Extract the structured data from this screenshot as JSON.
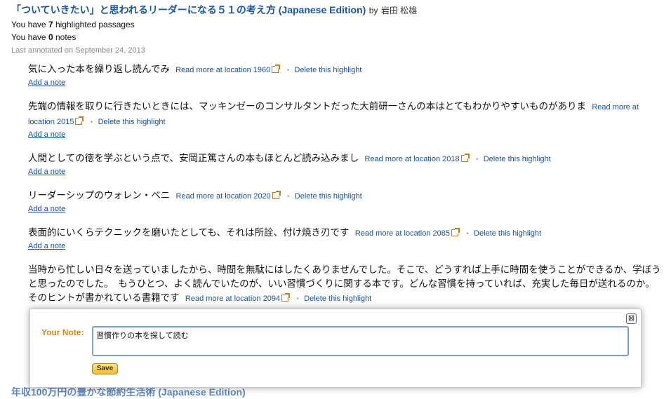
{
  "book": {
    "title": "「ついていきたい」と思われるリーダーになる５１の考え方 (Japanese Edition)",
    "by_label": "by",
    "author": "岩田 松雄",
    "stats": {
      "highlights_prefix": "You have",
      "highlights_count": "7",
      "highlights_suffix": "highlighted passages",
      "notes_prefix": "You have",
      "notes_count": "0",
      "notes_suffix": "notes"
    },
    "last_annotated": "Last annotated on September 24, 2013"
  },
  "highlights": [
    {
      "text": "気に入った本を繰り返し読んでみ",
      "read_more": "Read more at location 1960",
      "delete": "Delete this highlight",
      "add_note": "Add a note"
    },
    {
      "text": "先端の情報を取りに行きたいときには、マッキンゼーのコンサルタントだった大前研一さんの本はとてもわかりやすいものがありま",
      "read_more": "Read more at location 2015",
      "delete": "Delete this highlight",
      "add_note": "Add a note"
    },
    {
      "text": "人間としての徳を学ぶという点で、安岡正篤さんの本もほとんど読み込みまし",
      "read_more": "Read more at location 2018",
      "delete": "Delete this highlight",
      "add_note": "Add a note"
    },
    {
      "text": "リーダーシップのウォレン・ベニ",
      "read_more": "Read more at location 2020",
      "delete": "Delete this highlight",
      "add_note": "Add a note"
    },
    {
      "text": "表面的にいくらテクニックを磨いたとしても、それは所詮、付け焼き刃です",
      "read_more": "Read more at location 2085",
      "delete": "Delete this highlight",
      "add_note": "Add a note"
    },
    {
      "text": "当時から忙しい日々を送っていましたから、時間を無駄にはしたくありませんでした。そこで、どうすれば上手に時間を使うことができるか、学ぼうと思ったのでした。　もうひとつ、よく読んでいたのが、いい習慣づくりに関する本です。どんな習慣を持っていれば、充実した毎日が送れるのか。そのヒントが書かれている書籍です",
      "read_more": "Read more at location 2094",
      "delete": "Delete this highlight"
    }
  ],
  "note_editor": {
    "label": "Your Note:",
    "value": "習慣作りの本を探して読む",
    "save_label": "Save",
    "close_glyph": "⊠"
  },
  "next_book": {
    "title": "年収100万円の豊かな節約生活術 (Japanese Edition)"
  }
}
